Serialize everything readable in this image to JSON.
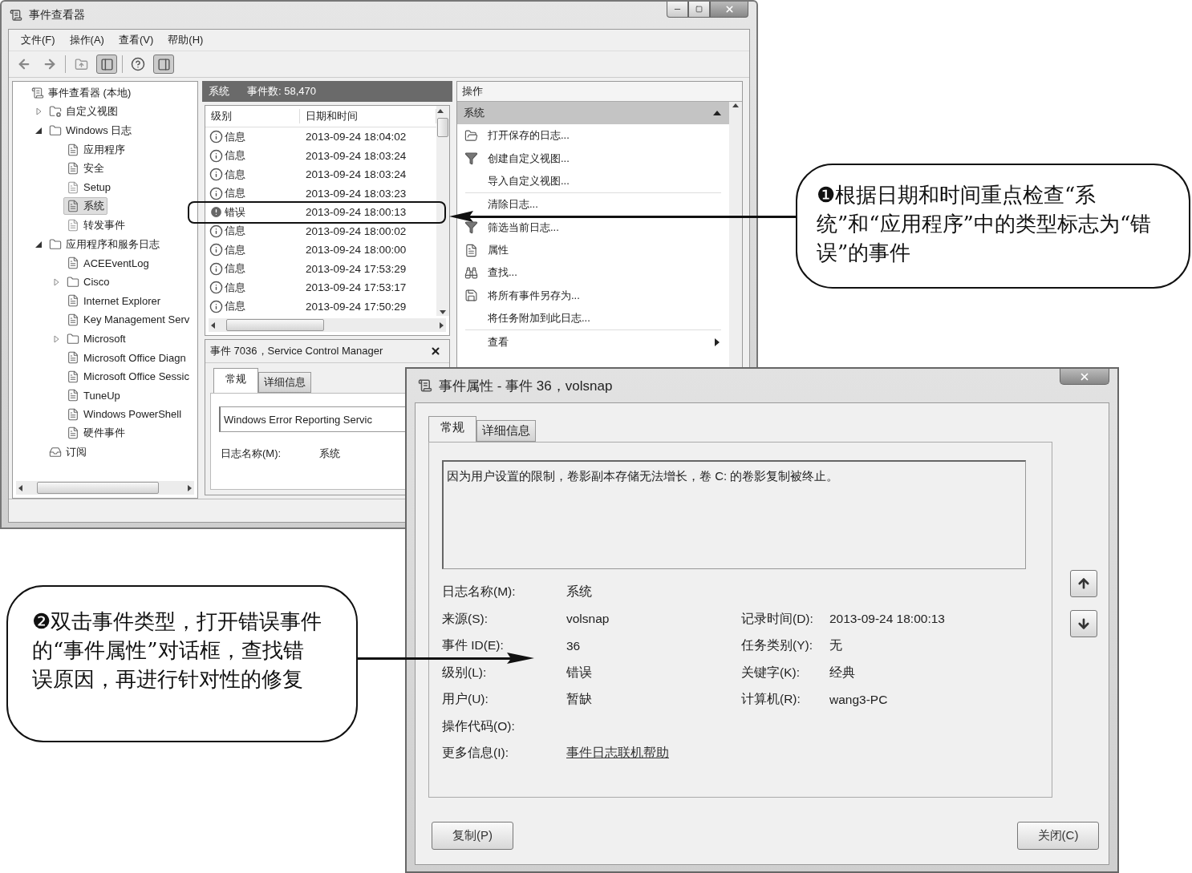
{
  "window": {
    "title": "事件查看器"
  },
  "menu": [
    "文件(F)",
    "操作(A)",
    "查看(V)",
    "帮助(H)"
  ],
  "tree": [
    {
      "label": "事件查看器 (本地)",
      "kind": "root",
      "selected": false,
      "children": [
        {
          "label": "自定义视图",
          "kind": "views",
          "expanded": false,
          "selected": false
        },
        {
          "label": "Windows 日志",
          "kind": "logs",
          "expanded": true,
          "selected": false,
          "children": [
            {
              "label": "应用程序",
              "kind": "log",
              "selected": false
            },
            {
              "label": "安全",
              "kind": "log",
              "selected": false
            },
            {
              "label": "Setup",
              "kind": "plain",
              "selected": false
            },
            {
              "label": "系统",
              "kind": "log",
              "selected": true
            },
            {
              "label": "转发事件",
              "kind": "plain",
              "selected": false
            }
          ]
        },
        {
          "label": "应用程序和服务日志",
          "kind": "logs",
          "expanded": true,
          "selected": false,
          "children": [
            {
              "label": "ACEEventLog",
              "kind": "log",
              "selected": false
            },
            {
              "label": "Cisco",
              "kind": "folder",
              "expanded": false,
              "selected": false
            },
            {
              "label": "Internet Explorer",
              "kind": "log",
              "selected": false
            },
            {
              "label": "Key Management Serv",
              "kind": "log",
              "selected": false
            },
            {
              "label": "Microsoft",
              "kind": "folder",
              "expanded": false,
              "selected": false
            },
            {
              "label": "Microsoft Office Diagn",
              "kind": "log",
              "selected": false
            },
            {
              "label": "Microsoft Office Sessic",
              "kind": "log",
              "selected": false
            },
            {
              "label": "TuneUp",
              "kind": "log",
              "selected": false
            },
            {
              "label": "Windows PowerShell",
              "kind": "log",
              "selected": false
            },
            {
              "label": "硬件事件",
              "kind": "log",
              "selected": false
            }
          ]
        },
        {
          "label": "订阅",
          "kind": "subscriptions",
          "selected": false
        }
      ]
    }
  ],
  "log_view": {
    "title": "系统",
    "count": "事件数: 58,470",
    "columns": [
      "级别",
      "日期和时间"
    ],
    "rows": [
      {
        "kind": "info",
        "level": "信息",
        "time": "2013-09-24 18:04:02"
      },
      {
        "kind": "info",
        "level": "信息",
        "time": "2013-09-24 18:03:24"
      },
      {
        "kind": "info",
        "level": "信息",
        "time": "2013-09-24 18:03:24"
      },
      {
        "kind": "info",
        "level": "信息",
        "time": "2013-09-24 18:03:23"
      },
      {
        "kind": "error",
        "level": "错误",
        "time": "2013-09-24 18:00:13"
      },
      {
        "kind": "info",
        "level": "信息",
        "time": "2013-09-24 18:00:02"
      },
      {
        "kind": "info",
        "level": "信息",
        "time": "2013-09-24 18:00:00"
      },
      {
        "kind": "info",
        "level": "信息",
        "time": "2013-09-24 17:53:29"
      },
      {
        "kind": "info",
        "level": "信息",
        "time": "2013-09-24 17:53:17"
      },
      {
        "kind": "info",
        "level": "信息",
        "time": "2013-09-24 17:50:29"
      }
    ]
  },
  "detail": {
    "title": "事件 7036，Service Control Manager",
    "tabs": [
      {
        "label": "常规",
        "selected": true
      },
      {
        "label": "详细信息",
        "selected": false
      }
    ],
    "description": "Windows Error Reporting Servic",
    "field": {
      "label": "日志名称(M):",
      "value": "系统"
    }
  },
  "actions": {
    "title": "操作",
    "section": "系统",
    "items": [
      {
        "kind": "open",
        "label": "打开保存的日志..."
      },
      {
        "kind": "filter",
        "label": "创建自定义视图..."
      },
      {
        "kind": "plain",
        "label": "导入自定义视图..."
      },
      {
        "kind": "separator"
      },
      {
        "kind": "plain",
        "label": "清除日志..."
      },
      {
        "kind": "filter",
        "label": "筛选当前日志..."
      },
      {
        "kind": "properties",
        "label": "属性"
      },
      {
        "kind": "find",
        "label": "查找..."
      },
      {
        "kind": "save",
        "label": "将所有事件另存为..."
      },
      {
        "kind": "plain",
        "label": "将任务附加到此日志..."
      },
      {
        "kind": "separator"
      },
      {
        "kind": "submenu",
        "label": "查看"
      }
    ]
  },
  "dialog": {
    "title": "事件属性 - 事件 36，volsnap",
    "tabs": [
      {
        "label": "常规",
        "selected": true
      },
      {
        "label": "详细信息",
        "selected": false
      }
    ],
    "description": "因为用户设置的限制，卷影副本存储无法增长，卷 C: 的卷影复制被终止。",
    "rows": [
      {
        "kind": "text",
        "label": "日志名称(M):",
        "value": "系统"
      },
      {
        "kind": "text",
        "label": "来源(S):",
        "value": "volsnap",
        "label_2": "记录时间(D):",
        "value_2": "2013-09-24 18:00:13"
      },
      {
        "kind": "text",
        "label": "事件 ID(E):",
        "value": "36",
        "label_2": "任务类别(Y):",
        "value_2": "无"
      },
      {
        "kind": "text",
        "label": "级别(L):",
        "value": "错误",
        "label_2": "关键字(K):",
        "value_2": "经典"
      },
      {
        "kind": "text",
        "label": "用户(U):",
        "value": "暂缺",
        "label_2": "计算机(R):",
        "value_2": "wang3-PC"
      },
      {
        "kind": "text",
        "label": "操作代码(O):"
      },
      {
        "kind": "link",
        "label": "更多信息(I):",
        "value": "事件日志联机帮助"
      }
    ],
    "buttons": [
      "复制(P)",
      "关闭(C)"
    ]
  },
  "callouts": [
    {
      "text": "❶根据日期和时间重点检查“系统”和“应用程序”中的类型标志为“错误”的事件"
    },
    {
      "text": "❷双击事件类型，打开错误事件的“事件属性”对话框，查找错误原因，再进行针对性的修复"
    }
  ]
}
